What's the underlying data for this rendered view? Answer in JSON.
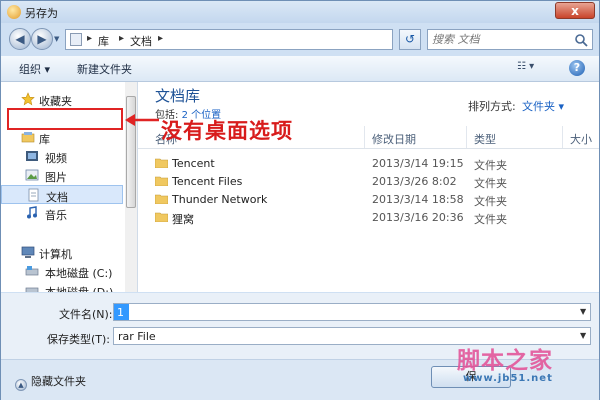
{
  "window": {
    "title": "另存为",
    "close_symbol": "x"
  },
  "nav": {
    "back_symbol": "◀",
    "forward_symbol": "▶",
    "address": [
      "库",
      "文档"
    ],
    "refresh_symbol": "↺",
    "search_placeholder": "搜索 文档"
  },
  "toolbar": {
    "organize_label": "组织 ▾",
    "new_folder_label": "新建文件夹",
    "view_symbol": "☷ ▾",
    "help_symbol": "?"
  },
  "sidebar": {
    "items": [
      {
        "label": "收藏夹",
        "icon": "star-icon"
      },
      {
        "label": "库",
        "icon": "library-icon"
      },
      {
        "label": "视频",
        "icon": "video-icon"
      },
      {
        "label": "图片",
        "icon": "picture-icon"
      },
      {
        "label": "文档",
        "icon": "document-icon"
      },
      {
        "label": "音乐",
        "icon": "music-icon"
      },
      {
        "label": "计算机",
        "icon": "computer-icon"
      },
      {
        "label": "本地磁盘 (C:)",
        "icon": "drive-icon"
      },
      {
        "label": "本地磁盘 (D:)",
        "icon": "drive-icon"
      }
    ],
    "selected": "文档"
  },
  "library": {
    "title": "文档库",
    "subtitle_prefix": "包括:",
    "subtitle_link": "2 个位置",
    "arrange_label": "排列方式:",
    "arrange_value": "文件夹 ▾"
  },
  "columns": [
    "名称",
    "修改日期",
    "类型",
    "大小"
  ],
  "files": [
    {
      "name": "Tencent",
      "date": "2013/3/14 19:15",
      "type": "文件夹"
    },
    {
      "name": "Tencent Files",
      "date": "2013/3/26 8:02",
      "type": "文件夹"
    },
    {
      "name": "Thunder Network",
      "date": "2013/3/14 18:58",
      "type": "文件夹"
    },
    {
      "name": "狸窝",
      "date": "2013/3/16 20:36",
      "type": "文件夹"
    }
  ],
  "form": {
    "filename_label": "文件名(N):",
    "filename_value": "1",
    "savetype_label": "保存类型(T):",
    "savetype_value": "rar File"
  },
  "footer": {
    "hide_folders_label": "隐藏文件夹",
    "save_label": "保"
  },
  "annotation": {
    "text": "没有桌面选项",
    "color": "#e02424"
  },
  "watermark": {
    "text": "脚本之家",
    "url": "www.jb51.net"
  }
}
